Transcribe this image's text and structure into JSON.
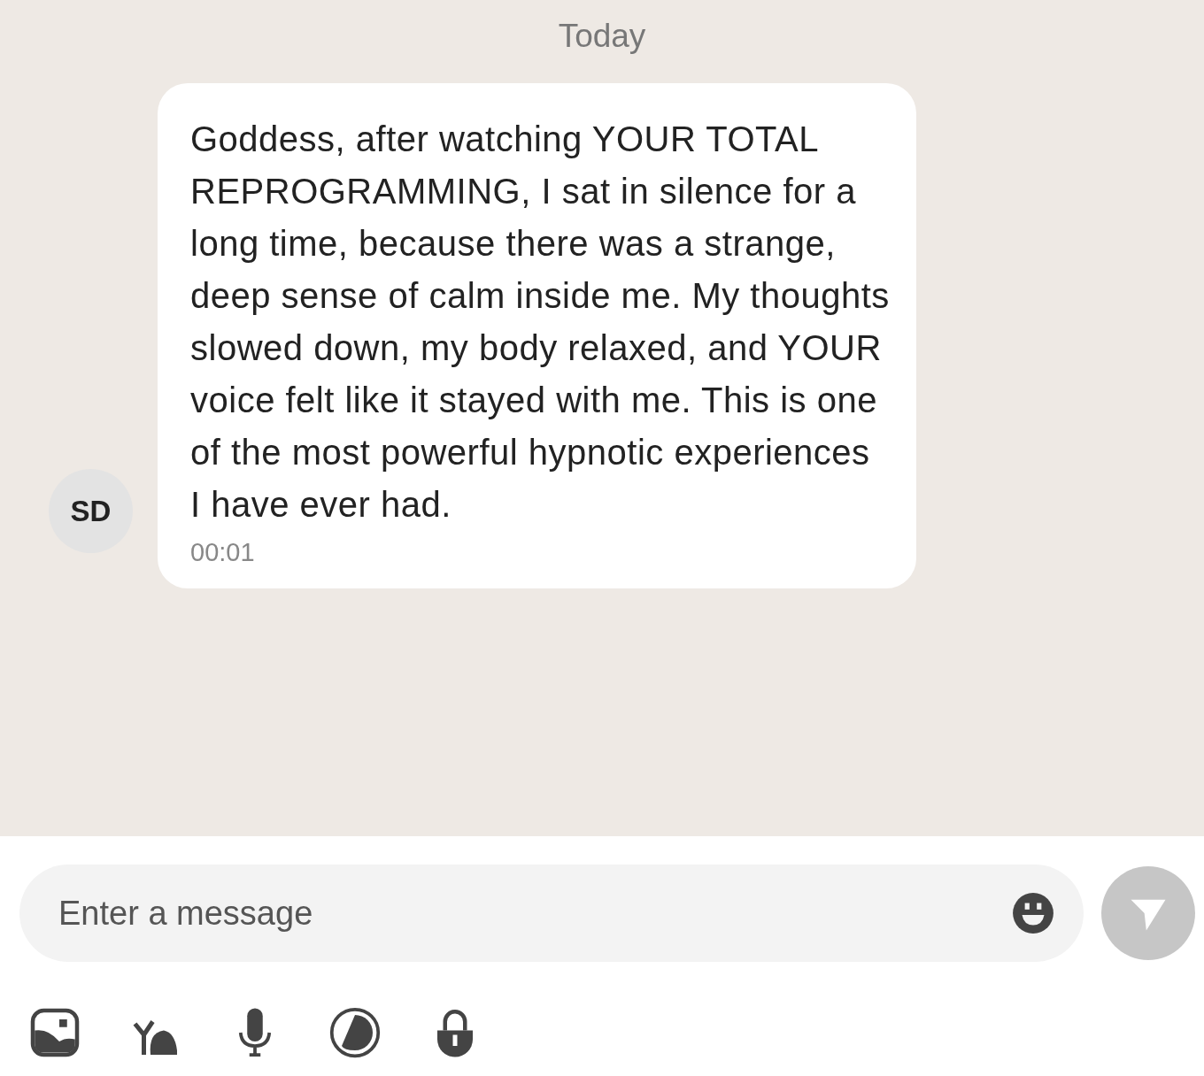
{
  "chat": {
    "date_divider": "Today",
    "messages": [
      {
        "avatar_initials": "SD",
        "text": "Goddess, after watching YOUR TOTAL REPROGRAMMING, I sat in silence for a long time, because there was a strange, deep sense of calm inside me. My thoughts slowed down, my body relaxed, and YOUR voice felt like it stayed with me. This is one of the most powerful hypnotic experiences I have ever had.",
        "time": "00:01"
      }
    ]
  },
  "composer": {
    "placeholder": "Enter a message",
    "send_enabled": false
  },
  "attachments": [
    {
      "kind": "image"
    },
    {
      "kind": "gift"
    },
    {
      "kind": "mic"
    },
    {
      "kind": "timer"
    },
    {
      "kind": "lock"
    }
  ]
}
